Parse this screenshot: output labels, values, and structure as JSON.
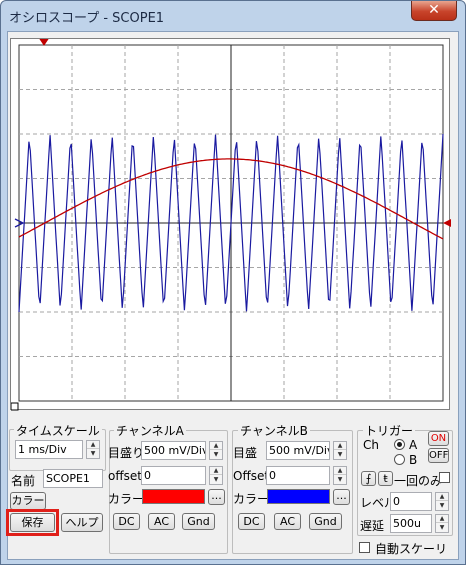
{
  "window": {
    "title": "オシロスコープ - SCOPE1",
    "close_symbol": "✕"
  },
  "scope": {
    "grid_color": "#a6a6a6",
    "trace_a_color": "#c00000",
    "trace_b_color": "#1a1aa0",
    "trigger_marker_color": "#c00000"
  },
  "timescale": {
    "group_label": "タイムスケール",
    "value": "1 ms/Div"
  },
  "name": {
    "label": "名前",
    "value": "SCOPE1"
  },
  "buttons": {
    "color": "カラー",
    "save": "保存",
    "help": "ヘルプ"
  },
  "channel_a": {
    "group_label": "チャンネルA",
    "scale_label": "目盛り",
    "scale_value": "500 mV/Div",
    "offset_label": "offset",
    "offset_value": "0",
    "color_label": "カラー",
    "color": "#ff0000",
    "more": "...",
    "coupling": [
      "DC",
      "AC",
      "Gnd"
    ]
  },
  "channel_b": {
    "group_label": "チャンネルB",
    "scale_label": "目盛",
    "scale_value": "500 mV/Div",
    "offset_label": "Offset",
    "offset_value": "0",
    "color_label": "カラー",
    "color": "#0000ff",
    "more": "...",
    "coupling": [
      "DC",
      "AC",
      "Gnd"
    ]
  },
  "trigger": {
    "group_label": "トリガー",
    "ch_label": "Ch",
    "ch_a": "A",
    "ch_b": "B",
    "selected": "A",
    "on_label": "ON",
    "off_label": "OFF",
    "edge_rise": "⨍",
    "edge_fall": "ŧ",
    "single_label": "一回のみ",
    "level_label": "レベル",
    "level_value": "0",
    "delay_label": "遅延",
    "delay_value": "500u",
    "auto_scale_label": "自動スケーリ"
  },
  "highlight_color": "#e0201a"
}
